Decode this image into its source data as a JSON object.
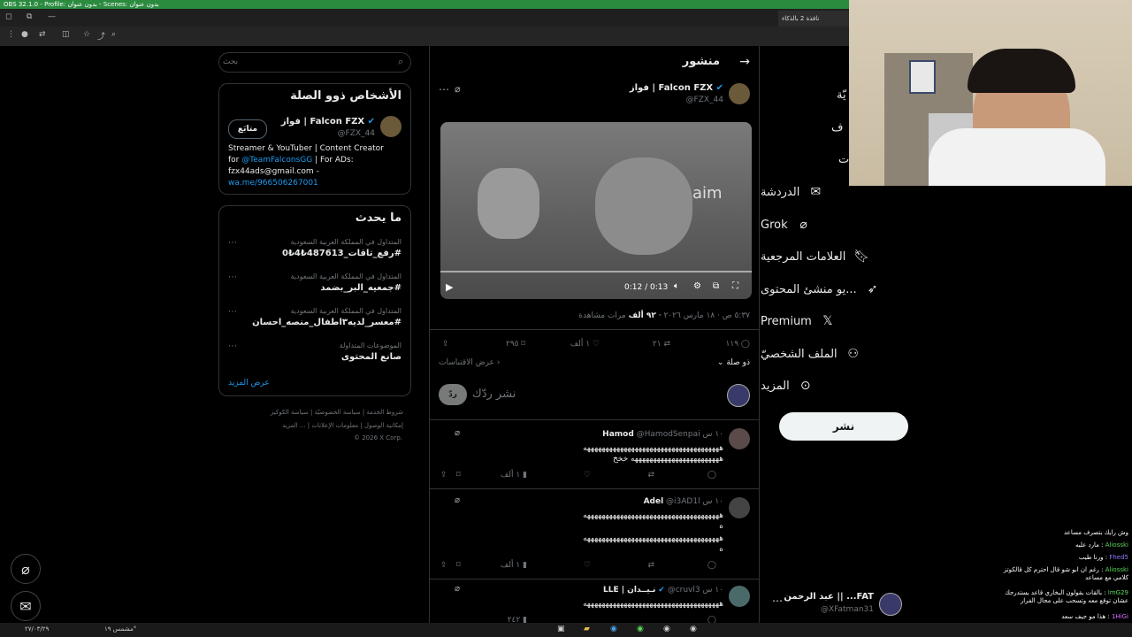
{
  "obs": {
    "title": "OBS 32.1.0 - Profile: بدون عنوان - Scenes: بدون عنوان"
  },
  "browser": {
    "tab_label": "نافذة 2 بالذكاء"
  },
  "nav": {
    "items": [
      {
        "label": "الدردشة",
        "icon": "mail-icon"
      },
      {
        "label": "Grok",
        "icon": "grok-icon"
      },
      {
        "label": "العلامات المرجعية",
        "icon": "bookmark-icon"
      },
      {
        "label": "...يو منشئ المحتوى",
        "icon": "rocket-icon"
      },
      {
        "label": "Premium",
        "icon": "x-logo-icon"
      },
      {
        "label": "الملف الشخصيّ",
        "icon": "person-icon"
      },
      {
        "label": "المزيد",
        "icon": "more-circle-icon"
      }
    ],
    "partial": [
      "يّة",
      "ف",
      "ت"
    ],
    "post_button": "نشر",
    "account": {
      "name": "FAT... || عبد الرحمن",
      "handle": "@XFatman31"
    }
  },
  "header": {
    "title": "منشور"
  },
  "post": {
    "author_name": "فواز | Falcon FZX",
    "author_handle": "@FZX_44",
    "video_time": "0:12 / 0:13",
    "meta_time": "٥:٣٧ ص · ١٨ مارس ٢٠٢٦",
    "views_count": "٩٢ ألف",
    "views_label": "مرات مشاهدة",
    "stats": {
      "replies": "١١٩",
      "reposts": "٢١",
      "likes": "١ ألف",
      "bookmarks": "٢٩٥"
    },
    "relevance": "ذو صلة",
    "quotes_link": "عرض الاقتباسات",
    "reply_placeholder": "نشر ردّك",
    "reply_button": "ردّ"
  },
  "replies": [
    {
      "name": "Hamod",
      "handle": "@HamodSenpai",
      "time": "١٠ س",
      "text1": "هههههههههههههههههههههههههههههههههههههه",
      "text2": "ههههههههههههههههههههههههه خخخ",
      "likes": "١ ألف"
    },
    {
      "name": "Adel",
      "handle": "@i3AD1l",
      "time": "١٠ س",
      "text1": "هههههههههههههههههههههههههههههههههههههه",
      "text2": "ه",
      "text3": "هههههههههههههههههههههههههههههههههههههه",
      "text4": "ه",
      "likes": "١ ألف"
    },
    {
      "name": "LLE | نـيــدان",
      "handle": "@cruvl3",
      "time": "١٠ س",
      "text1": "هههههههههههههههههههههههههههههههههههههه",
      "likes": "٢٤٢"
    }
  ],
  "sidebar": {
    "search_placeholder": "بحث",
    "related_title": "الأشخاص ذوو الصلة",
    "related": {
      "name": "فواز | Falcon FZX",
      "handle": "@FZX_44",
      "follow_label": "متابَع",
      "bio1": "Streamer & YouTuber | Content Creator",
      "bio2_prefix": "for ",
      "bio2_link": "@TeamFalconsGG",
      "bio2_suffix": " | For ADs:",
      "bio3": "fzx44ads@gmail.com -",
      "bio4": "wa.me/966506267001"
    },
    "trends_title": "ما يحدث",
    "trends": [
      {
        "context": "المتداول في المملكة العربية السعودية",
        "tag": "#رفع_تاقات_487613₺4₺0"
      },
      {
        "context": "المتداول في المملكة العربية السعودية",
        "tag": "#جمعيه_البر_بضمد"
      },
      {
        "context": "المتداول في المملكة العربية السعودية",
        "tag": "#معسر_لديه٣اطفال_منصه_احسان"
      },
      {
        "context": "الموضوعات المتداولة",
        "tag": "صانع المحتوى"
      }
    ],
    "show_more": "عرض المزيد",
    "footer1": [
      "شروط الخدمة",
      "سياسة الخصوصيّة",
      "سياسة الكوكيز"
    ],
    "footer2": [
      "إمكانية الوصول",
      "معلومات الإعلانات",
      "... المزيد"
    ],
    "copyright": "© 2026 X Corp."
  },
  "chat": [
    {
      "user": "",
      "text": "وش رايك بتصرف مساعد"
    },
    {
      "user": "Aliosski",
      "text": "مارد عليه"
    },
    {
      "user": "Fhed5",
      "text": "ورنا طيب"
    },
    {
      "user": "Aliosski",
      "text": "رغم ان ابو شو قال احترم كل قالكوتز كلامي مع مساعد"
    },
    {
      "user": "lmG29",
      "text": "بالقات يقولون البخاري قاعد يستدرجك عشان توقع معه وتسحب على مجال الفرار"
    },
    {
      "user": "1HiGi",
      "text": "هذا مو جيف سعد"
    }
  ],
  "taskbar": {
    "date": "٢٧/٠٣/٢٩",
    "weather": "مشمس ١٩°"
  }
}
